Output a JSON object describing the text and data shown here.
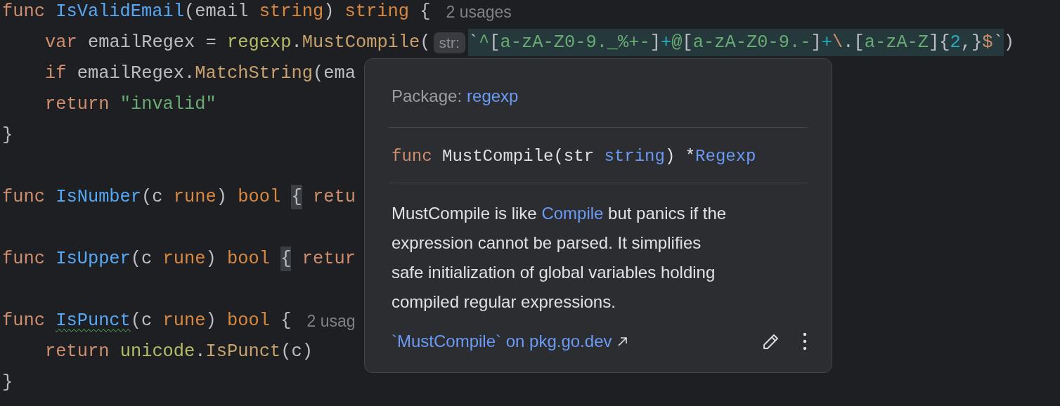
{
  "editor": {
    "lines": [
      {
        "kind": "code",
        "indented": false,
        "segments": [
          {
            "kind": "code",
            "tokens": [
              {
                "text": "func ",
                "kind": "keyword"
              },
              {
                "text": "IsValidEmail",
                "kind": "func"
              },
              {
                "text": "(email ",
                "kind": "plain"
              },
              {
                "text": "string",
                "kind": "type"
              },
              {
                "text": ") ",
                "kind": "plain"
              },
              {
                "text": "string",
                "kind": "type"
              },
              {
                "text": " {",
                "kind": "plain"
              }
            ]
          },
          {
            "kind": "usages",
            "text": "2 usages"
          }
        ]
      },
      {
        "kind": "code",
        "indented": true,
        "segments": [
          {
            "kind": "code",
            "tokens": [
              {
                "text": "var",
                "kind": "keyword"
              },
              {
                "text": " emailRegex = ",
                "kind": "plain"
              },
              {
                "text": "regexp",
                "kind": "pkg"
              },
              {
                "text": ".",
                "kind": "plain"
              },
              {
                "text": "MustCompile",
                "kind": "method"
              },
              {
                "text": "(",
                "kind": "plain"
              }
            ]
          },
          {
            "kind": "inlay",
            "text": "str:"
          },
          {
            "kind": "code",
            "tokens": [
              {
                "text": "`",
                "kind": "regex_punct"
              },
              {
                "text": "^",
                "kind": "regex_text"
              },
              {
                "text": "[",
                "kind": "regex_punct"
              },
              {
                "text": "a-zA-Z0-9._%+-",
                "kind": "regex_text"
              },
              {
                "text": "]",
                "kind": "regex_punct"
              },
              {
                "text": "+",
                "kind": "regex_op"
              },
              {
                "text": "@",
                "kind": "regex_text"
              },
              {
                "text": "[",
                "kind": "regex_punct"
              },
              {
                "text": "a-zA-Z0-9.-",
                "kind": "regex_text"
              },
              {
                "text": "]",
                "kind": "regex_punct"
              },
              {
                "text": "+",
                "kind": "regex_op"
              },
              {
                "text": "\\",
                "kind": "regex_escape"
              },
              {
                "text": ".[",
                "kind": "regex_punct"
              },
              {
                "text": "a-zA-Z",
                "kind": "regex_text"
              },
              {
                "text": "]{",
                "kind": "regex_punct"
              },
              {
                "text": "2",
                "kind": "regex_op"
              },
              {
                "text": ",}",
                "kind": "regex_punct"
              },
              {
                "text": "$",
                "kind": "regex_escape"
              },
              {
                "text": "`",
                "kind": "regex_punct"
              },
              {
                "text": ")",
                "kind": "plain"
              }
            ]
          }
        ]
      },
      {
        "kind": "code",
        "indented": true,
        "segments": [
          {
            "kind": "code",
            "tokens": [
              {
                "text": "if",
                "kind": "keyword"
              },
              {
                "text": " emailRegex.",
                "kind": "plain"
              },
              {
                "text": "MatchString",
                "kind": "method"
              },
              {
                "text": "(ema",
                "kind": "plain"
              }
            ]
          }
        ]
      },
      {
        "kind": "code",
        "indented": true,
        "segments": [
          {
            "kind": "code",
            "tokens": [
              {
                "text": "return ",
                "kind": "keyword"
              },
              {
                "text": "\"invalid\"",
                "kind": "string"
              }
            ]
          }
        ]
      },
      {
        "kind": "code",
        "indented": false,
        "segments": [
          {
            "kind": "code",
            "tokens": [
              {
                "text": "}",
                "kind": "plain"
              }
            ]
          }
        ]
      },
      {
        "kind": "blank"
      },
      {
        "kind": "code",
        "indented": false,
        "segments": [
          {
            "kind": "code",
            "tokens": [
              {
                "text": "func ",
                "kind": "keyword"
              },
              {
                "text": "IsNumber",
                "kind": "func"
              },
              {
                "text": "(c ",
                "kind": "plain"
              },
              {
                "text": "rune",
                "kind": "type"
              },
              {
                "text": ") ",
                "kind": "plain"
              },
              {
                "text": "bool ",
                "kind": "type"
              },
              {
                "text": "{",
                "kind": "brace_match"
              },
              {
                "text": " retu",
                "kind": "keyword"
              }
            ]
          }
        ]
      },
      {
        "kind": "blank"
      },
      {
        "kind": "code",
        "indented": false,
        "segments": [
          {
            "kind": "code",
            "tokens": [
              {
                "text": "func ",
                "kind": "keyword"
              },
              {
                "text": "IsUpper",
                "kind": "func"
              },
              {
                "text": "(c ",
                "kind": "plain"
              },
              {
                "text": "rune",
                "kind": "type"
              },
              {
                "text": ") ",
                "kind": "plain"
              },
              {
                "text": "bool ",
                "kind": "type"
              },
              {
                "text": "{",
                "kind": "brace_match"
              },
              {
                "text": " retur",
                "kind": "keyword"
              }
            ]
          }
        ]
      },
      {
        "kind": "blank"
      },
      {
        "kind": "code",
        "indented": false,
        "segments": [
          {
            "kind": "code",
            "tokens": [
              {
                "text": "func ",
                "kind": "keyword"
              },
              {
                "text": "IsPunct",
                "kind": "func_warning"
              },
              {
                "text": "(c ",
                "kind": "plain"
              },
              {
                "text": "rune",
                "kind": "type"
              },
              {
                "text": ") ",
                "kind": "plain"
              },
              {
                "text": "bool",
                "kind": "type"
              },
              {
                "text": " {",
                "kind": "plain"
              }
            ]
          },
          {
            "kind": "usages",
            "text": "2 usag"
          }
        ]
      },
      {
        "kind": "code",
        "indented": true,
        "segments": [
          {
            "kind": "code",
            "tokens": [
              {
                "text": "return ",
                "kind": "keyword"
              },
              {
                "text": "unicode",
                "kind": "pkg"
              },
              {
                "text": ".",
                "kind": "plain"
              },
              {
                "text": "IsPunct",
                "kind": "method"
              },
              {
                "text": "(c)",
                "kind": "plain"
              }
            ]
          }
        ]
      },
      {
        "kind": "code",
        "indented": false,
        "segments": [
          {
            "kind": "code",
            "tokens": [
              {
                "text": "}",
                "kind": "plain"
              }
            ]
          }
        ]
      }
    ]
  },
  "doc_popup": {
    "package_label": "Package:",
    "package_name": "regexp",
    "signature": [
      {
        "text": "func",
        "kind": "keyword"
      },
      {
        "text": " MustCompile(str ",
        "kind": "plain"
      },
      {
        "text": "string",
        "kind": "typelink"
      },
      {
        "text": ") *",
        "kind": "plain"
      },
      {
        "text": "Regexp",
        "kind": "typelink"
      }
    ],
    "description": [
      {
        "text": "MustCompile is like ",
        "kind": "text"
      },
      {
        "text": "Compile",
        "kind": "link"
      },
      {
        "text": " but panics if the expression cannot be parsed. It simplifies safe initialization of global variables holding compiled regular expressions.",
        "kind": "text"
      }
    ],
    "doc_link": "`MustCompile` on pkg.go.dev"
  }
}
